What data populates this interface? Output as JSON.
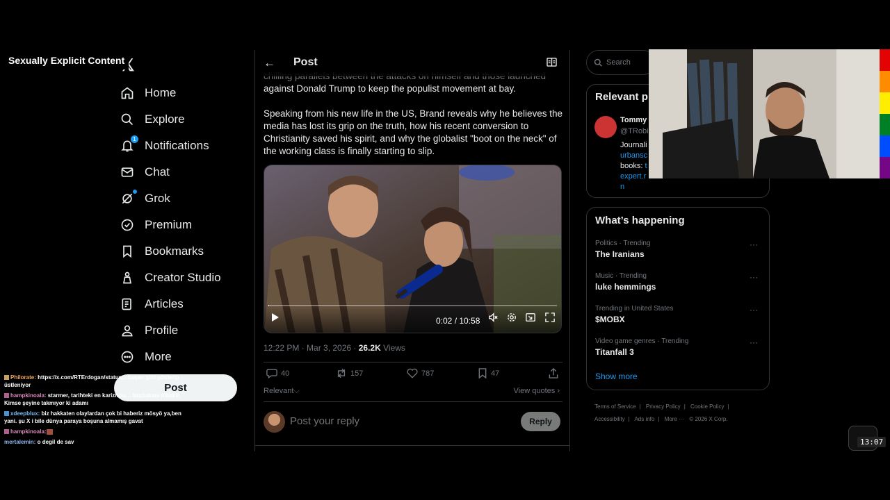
{
  "overlay": {
    "content_label": "Sexually Explicit Content",
    "clock": "13:07"
  },
  "nav": {
    "items": [
      {
        "label": "Home"
      },
      {
        "label": "Explore"
      },
      {
        "label": "Notifications",
        "badge": "1"
      },
      {
        "label": "Chat"
      },
      {
        "label": "Grok"
      },
      {
        "label": "Premium"
      },
      {
        "label": "Bookmarks"
      },
      {
        "label": "Creator Studio"
      },
      {
        "label": "Articles"
      },
      {
        "label": "Profile"
      },
      {
        "label": "More"
      }
    ],
    "post_button": "Post"
  },
  "chat": [
    {
      "user": "Philorate:",
      "text": " https://x.com/RTErdogan/status... başarı gibi gösterip üstleniyor",
      "color": "#f0a860"
    },
    {
      "user": "hampkinoala:",
      "text": " starmer, tarihteki en karizmas... başbakanı olabilir. Kimse şeyine takmıyor ki adamı",
      "color": "#d88ab8"
    },
    {
      "user": "xdeepblux:",
      "text": " biz hakkaten olaylardan çok bi haberiz mösyö ya,ben yani. şu X i bile dünya paraya boşuna almamış gavat",
      "color": "#7ab8f0"
    },
    {
      "user": "hampkinoala:",
      "text": " ",
      "color": "#d88ab8"
    },
    {
      "user": "mertalemin:",
      "text": " o degil de sav",
      "color": "#8ab8f0"
    }
  ],
  "post": {
    "header_title": "Post",
    "para_top_cut": "chilling parallels between the attacks on himself and those launched",
    "para_top": "against Donald Trump to keep the populist movement at bay.",
    "para_main": "Speaking from his new life in the US, Brand reveals why he believes the media has lost its grip on the truth, how his recent conversion to Christianity saved his spirit, and why the globalist \"boot on the neck\" of the working class is finally starting to slip.",
    "video": {
      "time": "0:02 / 10:58",
      "progress": 0.003
    },
    "timestamp": "12:22 PM · Mar 3, 2026 ·",
    "views_count": "26.2K",
    "views_label": "Views",
    "replies": "40",
    "reposts": "157",
    "likes": "787",
    "bookmarks": "47",
    "sort_label": "Relevant",
    "view_quotes": "View quotes",
    "reply_placeholder": "Post your reply",
    "reply_button": "Reply"
  },
  "search": {
    "placeholder": "Search"
  },
  "relevant_people": {
    "title": "Relevant p",
    "name": "Tommy",
    "handle": "@TRobi",
    "bio_line1": "Journali",
    "bio_link1": "urbansc",
    "bio_line2": "books: ",
    "bio_link2": "t",
    "bio_link3": "expert.r",
    "bio_link4": "n"
  },
  "happening": {
    "title": "What’s happening",
    "trends": [
      {
        "category": "Politics · Trending",
        "name": "The Iranians"
      },
      {
        "category": "Music · Trending",
        "name": "luke hemmings"
      },
      {
        "category": "Trending in United States",
        "name": "$MOBX"
      },
      {
        "category": "Video game genres · Trending",
        "name": "Titanfall 3"
      }
    ],
    "show_more": "Show more"
  },
  "footer": {
    "links": [
      "Terms of Service",
      "|",
      "Privacy Policy",
      "|",
      "Cookie Policy",
      "|",
      "Accessibility",
      "|",
      "Ads info",
      "|",
      "More ···",
      "© 2026 X Corp."
    ]
  },
  "colors": {
    "accent": "#1d9bf0",
    "background": "#000000",
    "border": "#2f3336",
    "muted": "#71767b"
  },
  "icons": [
    "home-icon",
    "search-icon",
    "bell-icon",
    "mail-icon",
    "grok-icon",
    "premium-icon",
    "bookmark-icon",
    "creator-studio-icon",
    "articles-icon",
    "profile-icon",
    "more-icon"
  ]
}
